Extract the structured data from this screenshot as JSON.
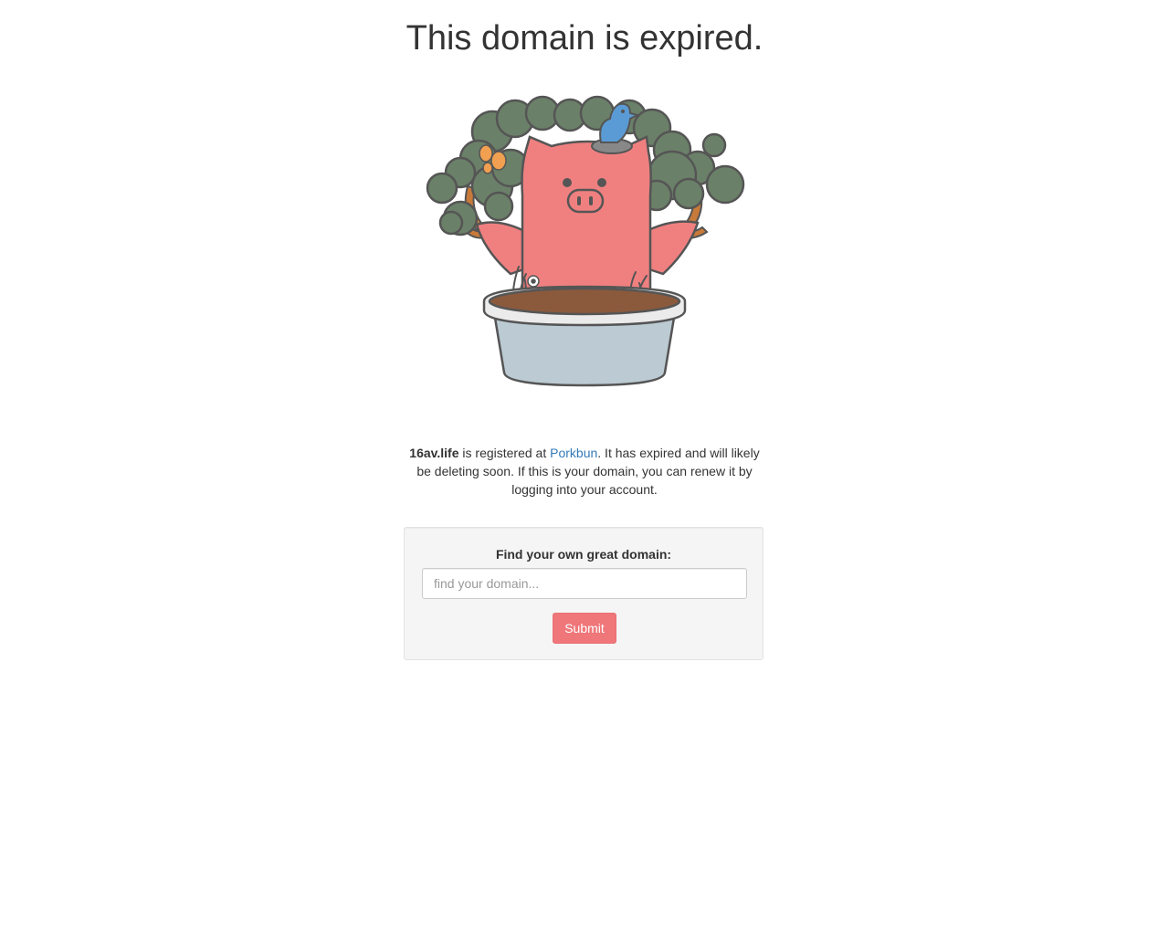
{
  "page": {
    "title": "This domain is expired."
  },
  "illustration": {
    "name": "pig-in-flowerpot-illustration",
    "colors": {
      "pig": "#f08080",
      "tree": "#6b8068",
      "outline": "#555555",
      "pot": "#bccbd3",
      "soil": "#8b5a3c",
      "bird": "#5b9bd5",
      "butterfly": "#f0a050",
      "branch": "#c87a3a"
    }
  },
  "message": {
    "domain": "16av.life",
    "text_before_link": " is registered at ",
    "registrar_link": "Porkbun",
    "text_after_link": ". It has expired and will likely be deleting soon. If this is your domain, you can renew it by logging into your account."
  },
  "search": {
    "label": "Find your own great domain:",
    "placeholder": "find your domain...",
    "value": "",
    "submit_label": "Submit"
  },
  "colors": {
    "link": "#337ab7",
    "button": "#ef7679",
    "panel_bg": "#f5f5f5"
  }
}
